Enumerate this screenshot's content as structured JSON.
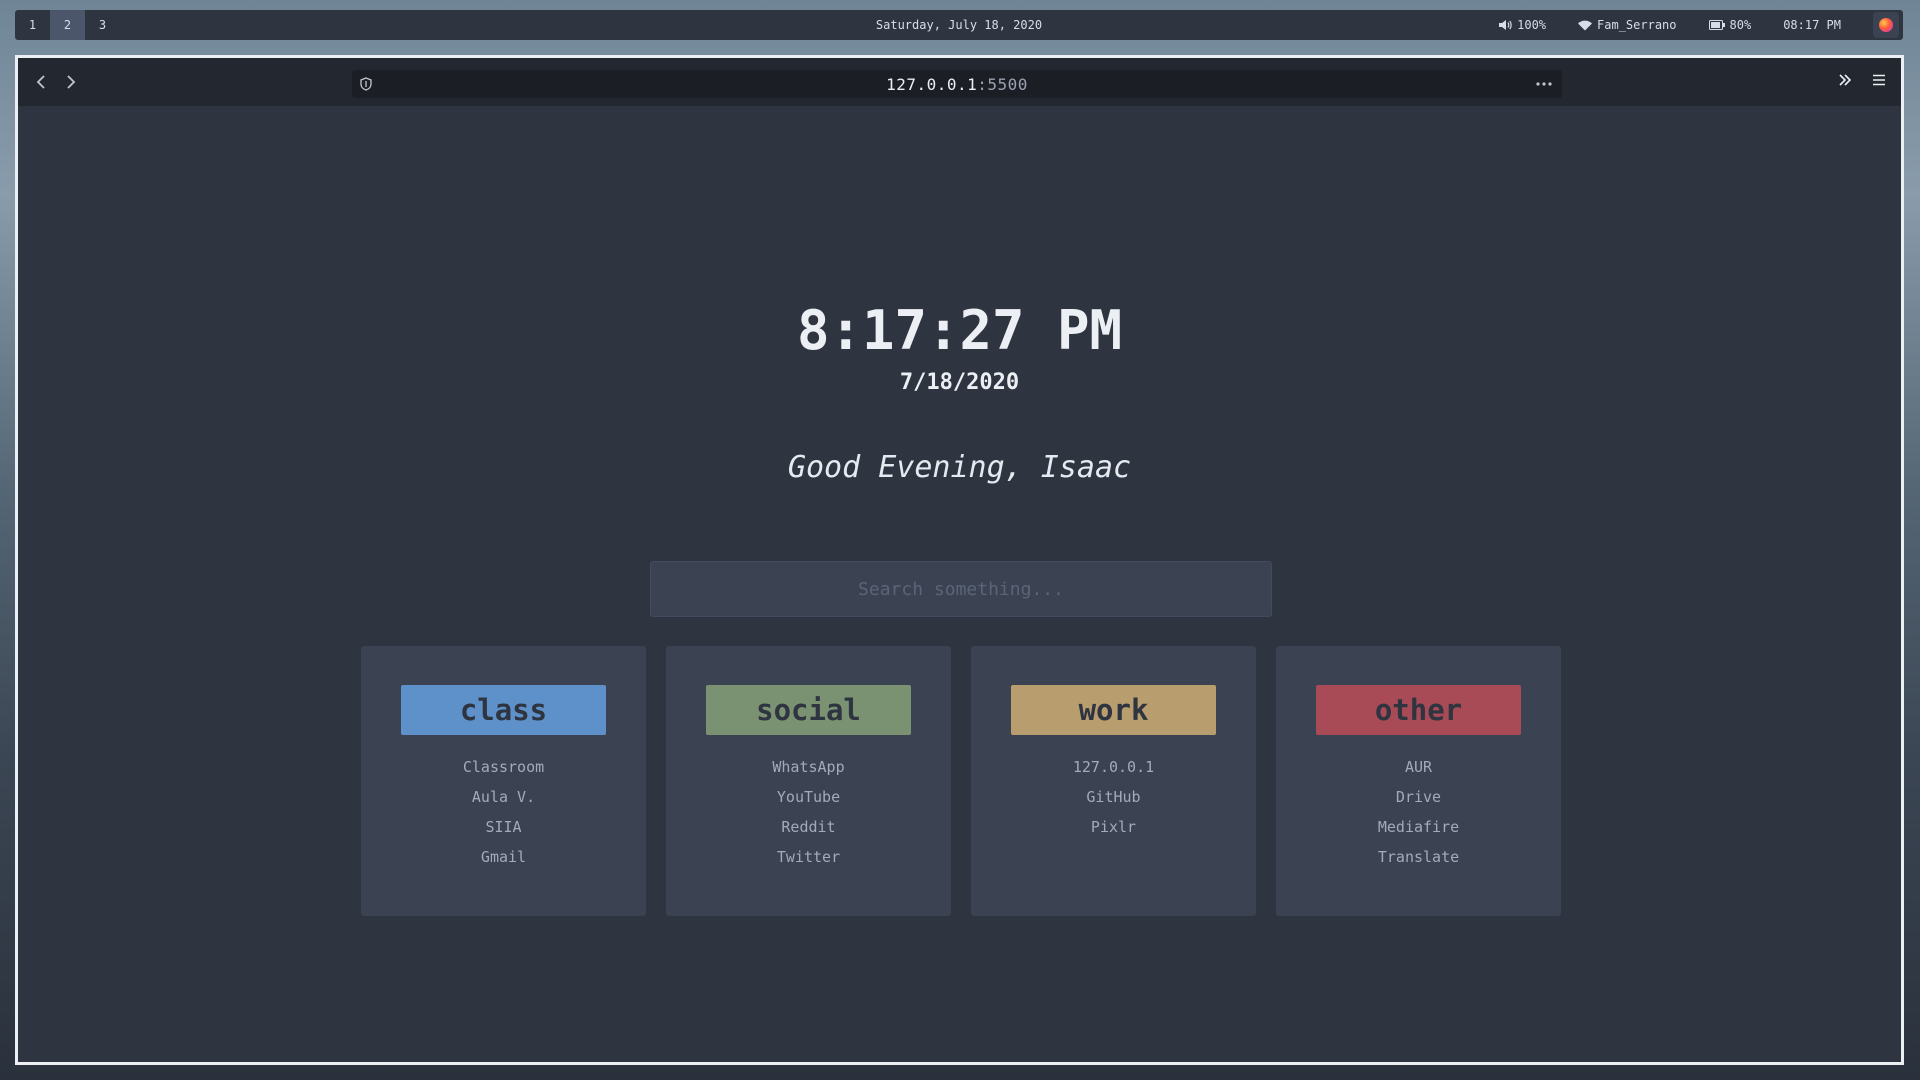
{
  "topbar": {
    "workspaces": [
      "1",
      "2",
      "3"
    ],
    "active_workspace": "2",
    "date": "Saturday, July 18, 2020",
    "volume": "100%",
    "wifi": "Fam_Serrano",
    "battery": "80%",
    "time": "08:17 PM",
    "icons": {
      "volume": "speaker-icon",
      "wifi": "wifi-icon",
      "battery": "battery-icon",
      "app": "app-logo-icon"
    }
  },
  "browser": {
    "url_host": "127.0.0.1",
    "url_port": ":5500",
    "icons": {
      "back": "chevron-left-icon",
      "forward": "chevron-right-icon",
      "shield": "shield-icon",
      "actions": "ellipsis-icon",
      "overflow": "double-chevron-right-icon",
      "menu": "hamburger-icon"
    }
  },
  "page": {
    "clock": "8:17:27 PM",
    "date": "7/18/2020",
    "greeting": "Good Evening, Isaac",
    "search_placeholder": "Search something...",
    "cards": [
      {
        "title": "class",
        "color": "#5e91c9",
        "links": [
          "Classroom",
          "Aula V.",
          "SIIA",
          "Gmail"
        ]
      },
      {
        "title": "social",
        "color": "#7b9272",
        "links": [
          "WhatsApp",
          "YouTube",
          "Reddit",
          "Twitter"
        ]
      },
      {
        "title": "work",
        "color": "#b89e6f",
        "links": [
          "127.0.0.1",
          "GitHub",
          "Pixlr"
        ]
      },
      {
        "title": "other",
        "color": "#a84b56",
        "links": [
          "AUR",
          "Drive",
          "Mediafire",
          "Translate"
        ]
      }
    ]
  },
  "colors": {
    "bg": "#2e3440",
    "card_bg": "#3b4252",
    "text": "#eceff4",
    "link": "#a3abba"
  }
}
